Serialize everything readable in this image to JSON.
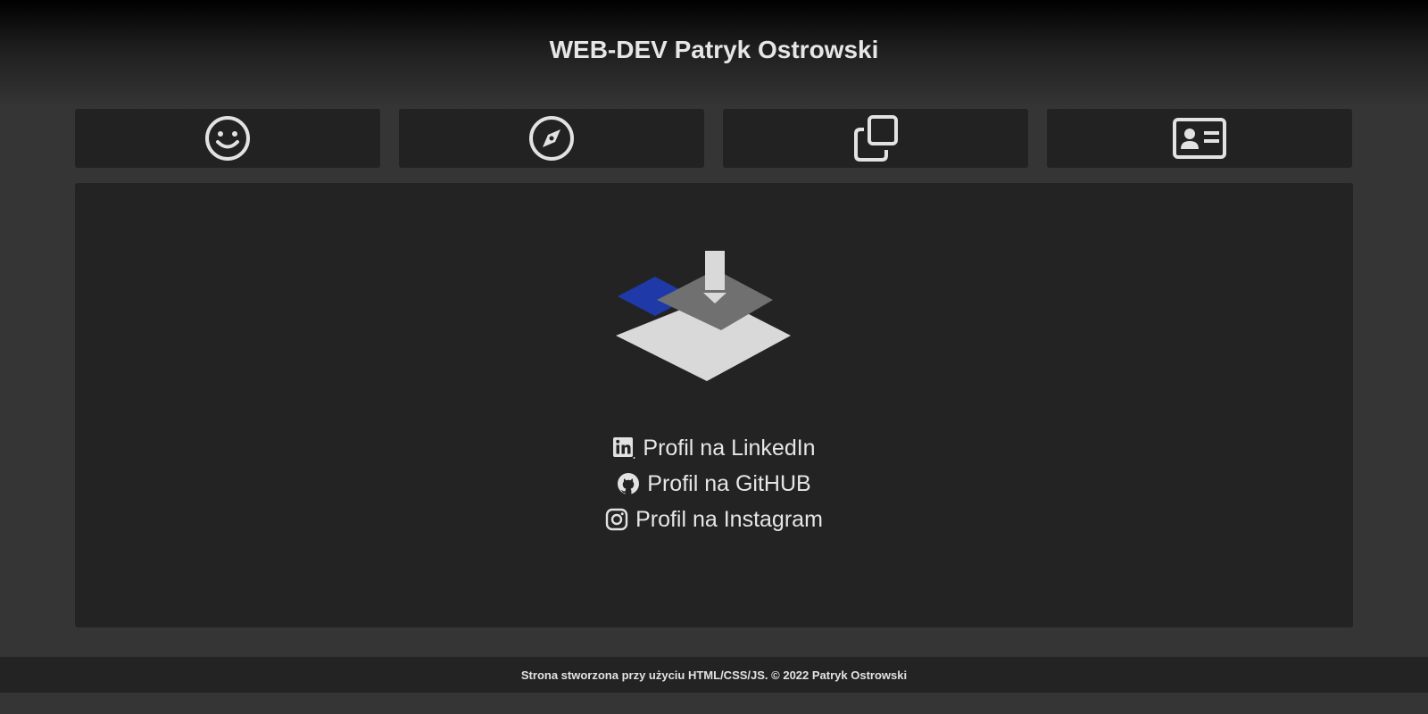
{
  "header": {
    "title": "WEB-DEV Patryk Ostrowski"
  },
  "nav": {
    "tiles": [
      {
        "icon": "smiley-icon"
      },
      {
        "icon": "compass-icon"
      },
      {
        "icon": "copy-icon"
      },
      {
        "icon": "id-card-icon"
      }
    ]
  },
  "main": {
    "logo_icon": "layers-download-logo",
    "links": [
      {
        "icon": "linkedin-icon",
        "label": "Profil na LinkedIn"
      },
      {
        "icon": "github-icon",
        "label": "Profil na GitHUB"
      },
      {
        "icon": "instagram-icon",
        "label": "Profil na Instagram"
      }
    ]
  },
  "footer": {
    "text": "Strona stworzona przy użyciu HTML/CSS/JS. © 2022 Patryk Ostrowski"
  },
  "colors": {
    "page_background": "#353535",
    "panel_background": "#232323",
    "text": "#e2e2e2",
    "logo_blue": "#1f3aa8",
    "logo_gray": "#707070",
    "logo_light": "#d9d9d9"
  }
}
